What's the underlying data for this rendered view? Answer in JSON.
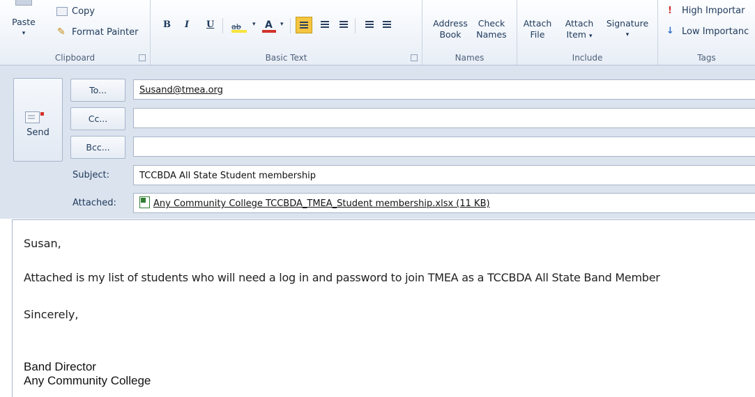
{
  "ribbon": {
    "clipboard": {
      "paste": "Paste",
      "copy": "Copy",
      "format_painter": "Format Painter",
      "label": "Clipboard"
    },
    "basic_text": {
      "bold": "B",
      "italic": "I",
      "underline": "U",
      "highlight": "ab",
      "font_color": "A",
      "label": "Basic Text"
    },
    "names": {
      "address_book_1": "Address",
      "address_book_2": "Book",
      "check_names_1": "Check",
      "check_names_2": "Names",
      "label": "Names"
    },
    "include": {
      "attach_file_1": "Attach",
      "attach_file_2": "File",
      "attach_item_1": "Attach",
      "attach_item_2": "Item",
      "signature": "Signature",
      "label": "Include"
    },
    "tags": {
      "high_importance": "High Importar",
      "low_importance": "Low Importanc",
      "label": "Tags"
    }
  },
  "compose": {
    "send": "Send",
    "to_button": "To...",
    "cc_button": "Cc...",
    "bcc_button": "Bcc...",
    "to_value": "Susand@tmea.org",
    "cc_value": "",
    "bcc_value": "",
    "subject_label": "Subject:",
    "subject_value": "TCCBDA All State Student membership",
    "attached_label": "Attached:",
    "attachment": "Any Community College TCCBDA_TMEA_Student membership.xlsx (11 KB)"
  },
  "body": {
    "greeting": "Susan,",
    "line1": "Attached is my list of students who will need a log in and password to join TMEA as a TCCBDA All State Band Member",
    "closing": "Sincerely,",
    "sig_title": "Band Director",
    "sig_org": "Any Community College"
  },
  "colors": {
    "ribbon_text": "#1e395b",
    "align_active": "#f5c542"
  }
}
